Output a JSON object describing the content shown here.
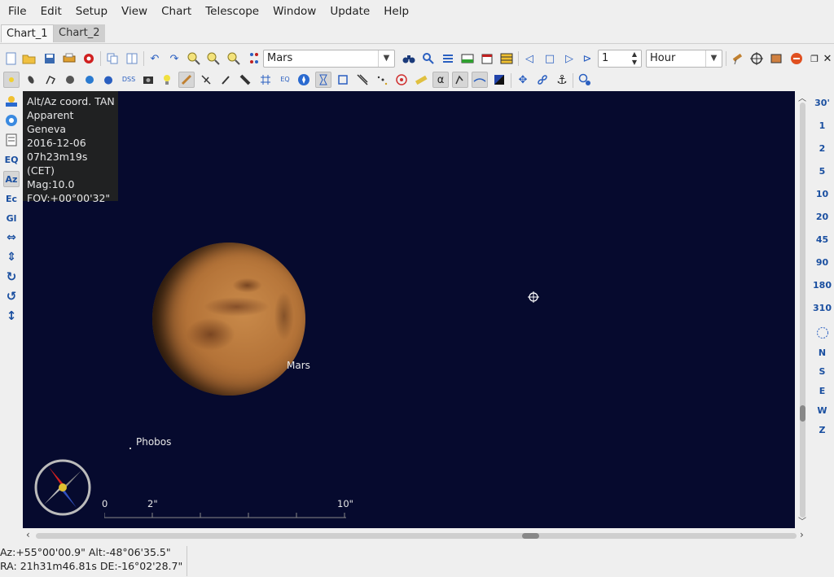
{
  "menu": [
    "File",
    "Edit",
    "Setup",
    "View",
    "Chart",
    "Telescope",
    "Window",
    "Update",
    "Help"
  ],
  "tabs": [
    {
      "label": "Chart_1",
      "active": true
    },
    {
      "label": "Chart_2",
      "active": false
    }
  ],
  "toolbar": {
    "object_search": {
      "value": "Mars"
    },
    "step_count": {
      "value": "1"
    },
    "time_unit": {
      "value": "Hour"
    }
  },
  "left_toolbar": {
    "items": [
      "EQ",
      "Az",
      "Ec",
      "Gl"
    ]
  },
  "info_panel": {
    "lines": [
      "Alt/Az coord. TAN",
      "Apparent",
      "Geneva",
      "2016-12-06",
      "07h23m19s (CET)",
      "Mag:10.0",
      "FOV:+00°00'32\""
    ]
  },
  "sky": {
    "mars_label": "Mars",
    "phobos_label": "Phobos",
    "scale_labels": [
      "0",
      "2\"",
      "10\""
    ]
  },
  "fov_bar": {
    "fov_values": [
      "30'",
      "1",
      "2",
      "5",
      "10",
      "20",
      "45",
      "90",
      "180",
      "310"
    ],
    "directions": [
      "N",
      "S",
      "E",
      "W",
      "Z"
    ]
  },
  "status": {
    "line1": "Az:+55°00'00.9\" Alt:-48°06'35.5\"",
    "line2": "RA: 21h31m46.81s DE:-16°02'28.7\""
  },
  "colors": {
    "sky_background": "#060a2e",
    "icon_blue": "#1a4fa0"
  }
}
